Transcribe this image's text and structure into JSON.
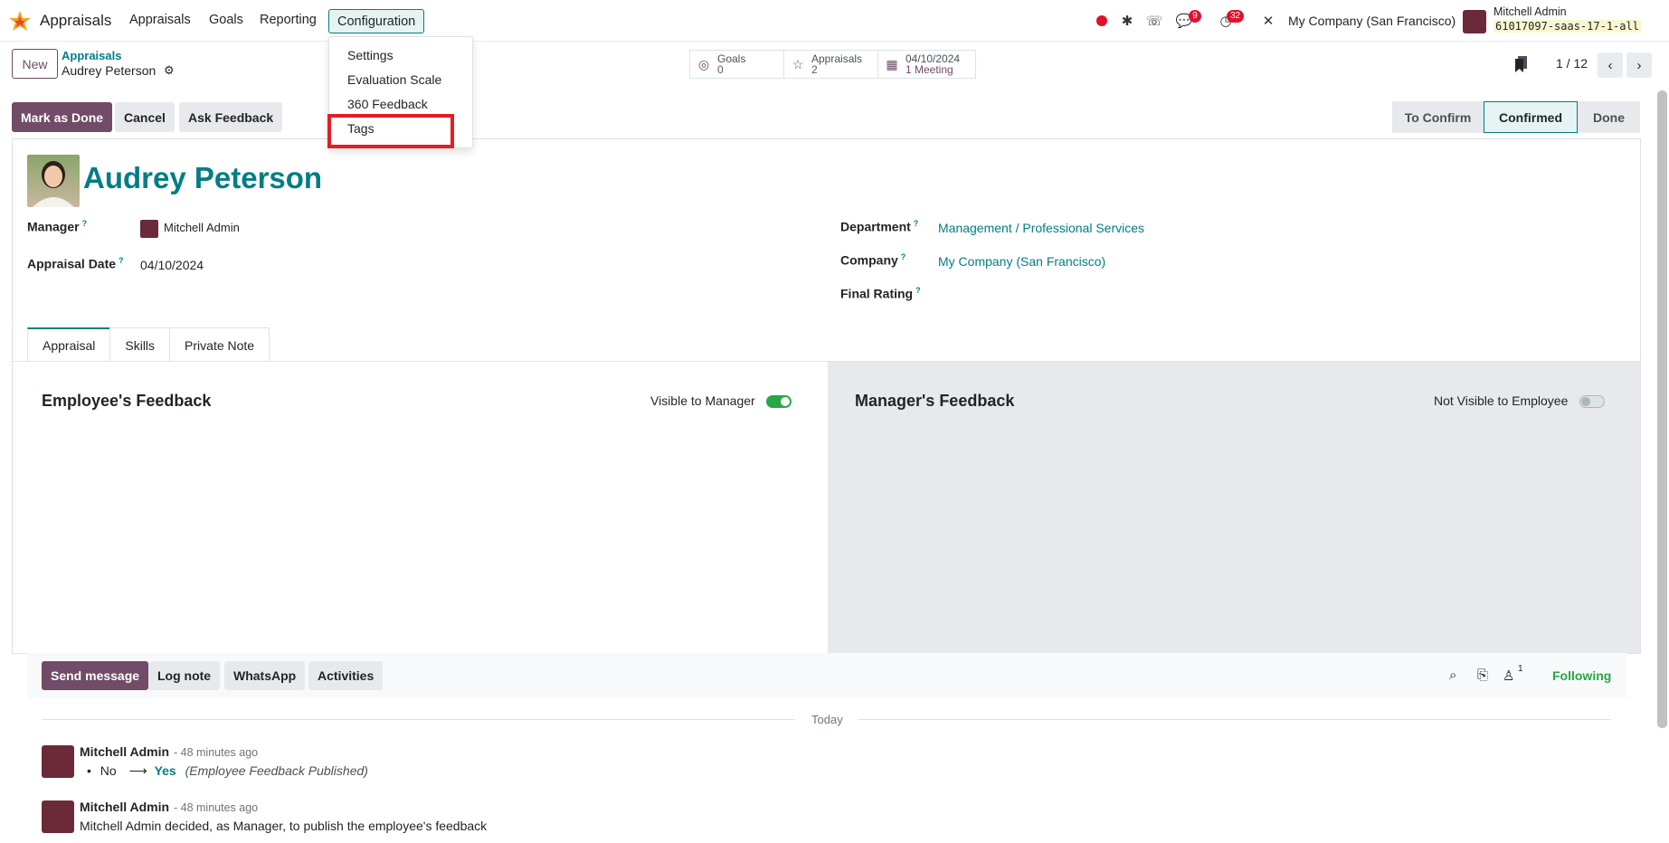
{
  "navbar": {
    "app_name": "Appraisals",
    "menus": [
      "Appraisals",
      "Goals",
      "Reporting",
      "Configuration"
    ],
    "badges": {
      "messages": "9",
      "activities": "32"
    },
    "company": "My Company (San Francisco)",
    "user_name": "Mitchell Admin",
    "database": "61017097-saas-17-1-all"
  },
  "config_menu": {
    "items": [
      "Settings",
      "Evaluation Scale",
      "360 Feedback",
      "Tags"
    ]
  },
  "control_panel": {
    "new_label": "New",
    "breadcrumb_parent": "Appraisals",
    "breadcrumb_current": "Audrey Peterson",
    "smart_buttons": {
      "goals": {
        "label": "Goals",
        "value": "0"
      },
      "appraisals": {
        "label": "Appraisals",
        "value": "2"
      },
      "meeting": {
        "label": "04/10/2024",
        "value": "1 Meeting"
      }
    },
    "pager": "1 / 12"
  },
  "actions": {
    "mark_done": "Mark as Done",
    "cancel": "Cancel",
    "ask_feedback": "Ask Feedback"
  },
  "stages": [
    "To Confirm",
    "Confirmed",
    "Done"
  ],
  "record": {
    "employee_name": "Audrey Peterson",
    "fields": {
      "manager_label": "Manager",
      "manager_value": "Mitchell Admin",
      "appraisal_date_label": "Appraisal Date",
      "appraisal_date_value": "04/10/2024",
      "department_label": "Department",
      "department_value": "Management / Professional Services",
      "company_label": "Company",
      "company_value": "My Company (San Francisco)",
      "final_rating_label": "Final Rating",
      "help_mark": "?"
    }
  },
  "tabs": [
    "Appraisal",
    "Skills",
    "Private Note"
  ],
  "feedback": {
    "employee_title": "Employee's Feedback",
    "employee_toggle_label": "Visible to Manager",
    "manager_title": "Manager's Feedback",
    "manager_toggle_label": "Not Visible to Employee"
  },
  "chatter": {
    "send_message": "Send message",
    "log_note": "Log note",
    "whatsapp": "WhatsApp",
    "activities": "Activities",
    "followers_count": "1",
    "following": "Following",
    "date_separator": "Today",
    "messages": [
      {
        "author": "Mitchell Admin",
        "time": "- 48 minutes ago",
        "change_old": "No",
        "change_arrow": "⟶",
        "change_new": "Yes",
        "change_field": "(Employee Feedback Published)"
      },
      {
        "author": "Mitchell Admin",
        "time": "- 48 minutes ago",
        "body": "Mitchell Admin decided, as Manager, to publish the employee's feedback"
      }
    ]
  }
}
